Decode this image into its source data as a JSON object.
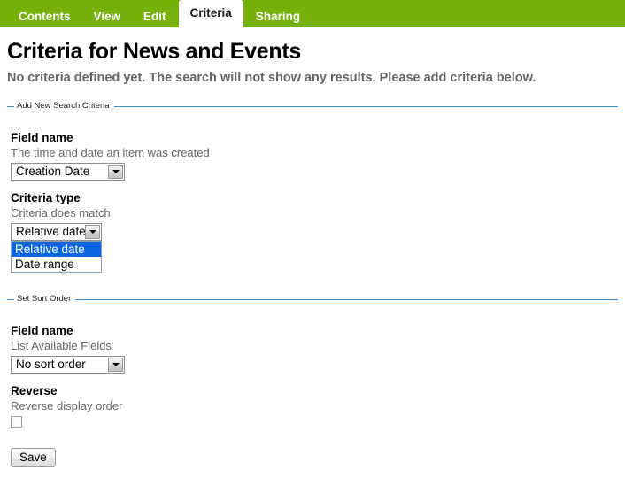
{
  "tabs": [
    {
      "label": "Contents",
      "active": false
    },
    {
      "label": "View",
      "active": false
    },
    {
      "label": "Edit",
      "active": false
    },
    {
      "label": "Criteria",
      "active": true
    },
    {
      "label": "Sharing",
      "active": false
    }
  ],
  "page": {
    "title": "Criteria for News and Events",
    "description": "No criteria defined yet. The search will not show any results. Please add criteria below."
  },
  "colors": {
    "tabbar_green": "#76b00b",
    "legend_blue": "#3f8fca",
    "highlight_blue": "#0a64e4",
    "help_text_gray": "#666666",
    "description_gray": "#656565"
  },
  "add_criteria": {
    "legend": "Add New Search Criteria",
    "field_name": {
      "label": "Field name",
      "help": "The time and date an item was created",
      "value": "Creation Date"
    },
    "criteria_type": {
      "label": "Criteria type",
      "help": "Criteria does match",
      "value": "Relative date",
      "open": true,
      "options": [
        {
          "label": "Relative date",
          "selected": true
        },
        {
          "label": "Date range",
          "selected": false
        }
      ]
    }
  },
  "sort_order": {
    "legend": "Set Sort Order",
    "field_name": {
      "label": "Field name",
      "help": "List Available Fields",
      "value": "No sort order"
    },
    "reverse": {
      "label": "Reverse",
      "help": "Reverse display order",
      "checked": false
    }
  },
  "actions": {
    "save_label": "Save"
  }
}
